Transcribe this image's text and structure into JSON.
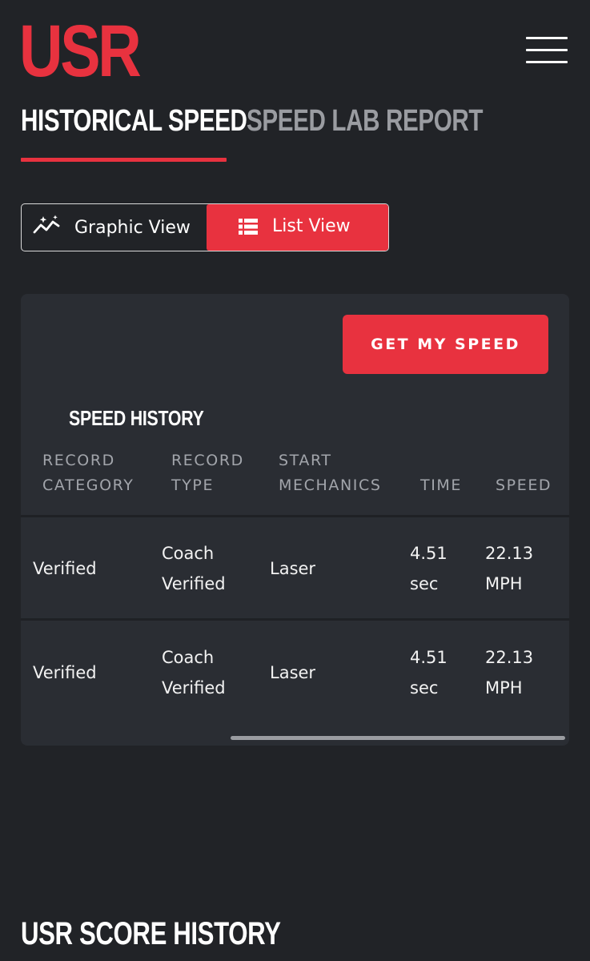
{
  "header": {
    "logo_text": "USR",
    "menu_icon": "hamburger-menu-icon"
  },
  "tabs": [
    {
      "label": "HISTORICAL SPEED",
      "active": true
    },
    {
      "label": "SPEED LAB REPORT",
      "active": false
    }
  ],
  "view_toggle": {
    "graphic": {
      "label": "Graphic View",
      "icon": "trend-chart-icon"
    },
    "list": {
      "label": "List View",
      "icon": "list-icon",
      "active": true
    }
  },
  "card": {
    "cta_label": "GET MY SPEED",
    "section_title": "SPEED HISTORY",
    "columns": [
      {
        "line1": "RECORD",
        "line2": "CATEGORY"
      },
      {
        "line1": "RECORD",
        "line2": "TYPE"
      },
      {
        "line1": "START",
        "line2": "MECHANICS"
      },
      {
        "line1": "",
        "line2": "TIME"
      },
      {
        "line1": "",
        "line2": "SPEED"
      }
    ],
    "rows": [
      {
        "category": "Verified",
        "type_line1": "Coach",
        "type_line2": "Verified",
        "mechanics": "Laser",
        "time_line1": "4.51",
        "time_line2": "sec",
        "speed_line1": "22.13",
        "speed_line2": "MPH"
      },
      {
        "category": "Verified",
        "type_line1": "Coach",
        "type_line2": "Verified",
        "mechanics": "Laser",
        "time_line1": "4.51",
        "time_line2": "sec",
        "speed_line1": "22.13",
        "speed_line2": "MPH"
      }
    ]
  },
  "bottom_section_title": "USR SCORE HISTORY",
  "colors": {
    "accent": "#e8323f",
    "background": "#212327",
    "card": "#2a2d33",
    "muted_text": "#a2a5ab"
  }
}
